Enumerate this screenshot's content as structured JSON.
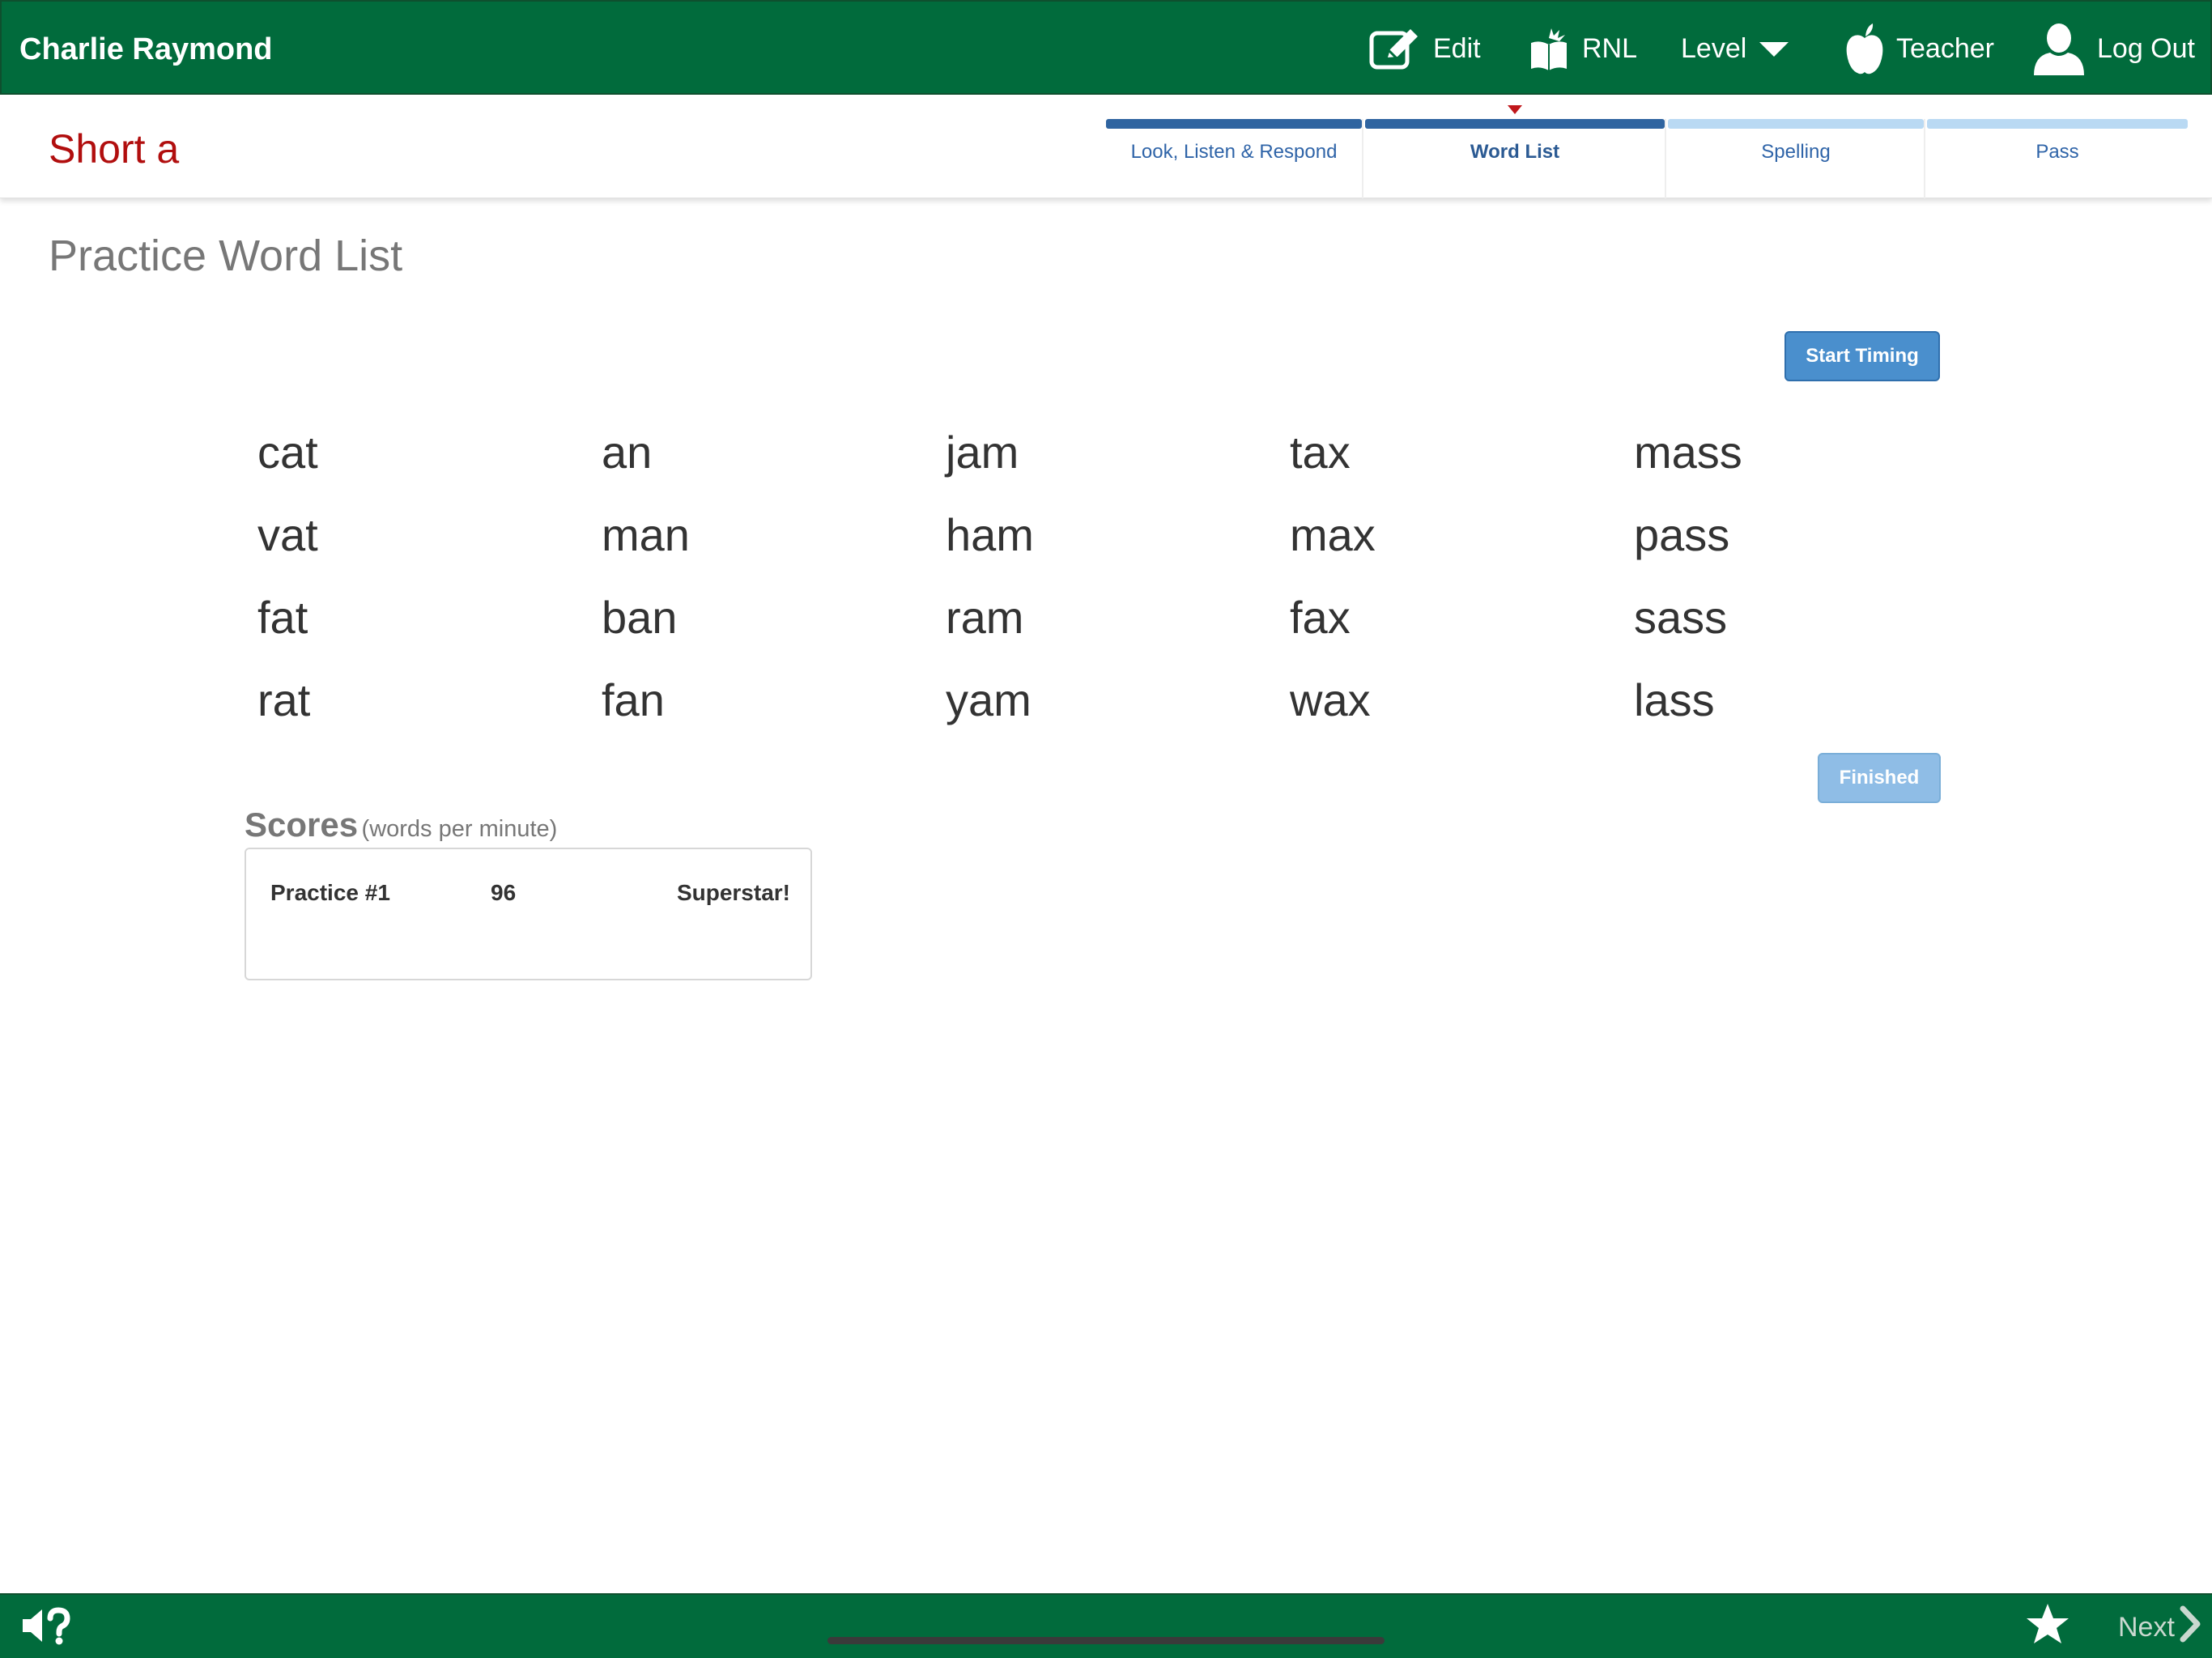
{
  "header": {
    "user_name": "Charlie Raymond",
    "nav": {
      "edit": "Edit",
      "rnl": "RNL",
      "level": "Level",
      "teacher": "Teacher",
      "logout": "Log Out"
    }
  },
  "lesson": {
    "title": "Short a",
    "steps": [
      {
        "label": "Look, Listen & Respond",
        "state": "done"
      },
      {
        "label": "Word List",
        "state": "current"
      },
      {
        "label": "Spelling",
        "state": "todo"
      },
      {
        "label": "Pass",
        "state": "todo"
      }
    ]
  },
  "main": {
    "heading": "Practice Word List",
    "start_button": "Start Timing",
    "finished_button": "Finished",
    "word_rows": [
      [
        "cat",
        "an",
        "jam",
        "tax",
        "mass"
      ],
      [
        "vat",
        "man",
        "ham",
        "max",
        "pass"
      ],
      [
        "fat",
        "ban",
        "ram",
        "fax",
        "sass"
      ],
      [
        "rat",
        "fan",
        "yam",
        "wax",
        "lass"
      ]
    ]
  },
  "scores": {
    "title": "Scores",
    "unit": "(words per minute)",
    "rows": [
      {
        "name": "Practice #1",
        "value": "96",
        "badge": "Superstar!"
      }
    ]
  },
  "footer": {
    "next_label": "Next",
    "audio_help_icon": "speaker-question-icon",
    "star_icon": "star-icon",
    "next_icon": "chevron-right-icon"
  },
  "colors": {
    "brand_green": "#016b3c",
    "lesson_title_red": "#b10e0e",
    "step_done": "#2f64a0",
    "step_todo": "#b9d9f3",
    "button_blue": "#4a8fcd",
    "button_disabled_blue": "#8fbde6"
  }
}
